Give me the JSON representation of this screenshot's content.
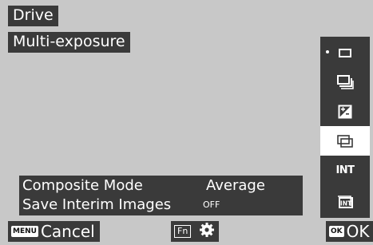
{
  "header": {
    "title": "Drive",
    "mode": "Multi-exposure"
  },
  "drive_options": [
    {
      "icon": "single-frame-icon",
      "selected": false,
      "current": true
    },
    {
      "icon": "continuous-shooting-icon",
      "selected": false,
      "current": false
    },
    {
      "icon": "exposure-bracketing-icon",
      "selected": false,
      "current": false
    },
    {
      "icon": "multi-exposure-icon",
      "selected": true,
      "current": false
    },
    {
      "icon": "interval-shooting-icon",
      "label": "INT",
      "selected": false,
      "current": false
    },
    {
      "icon": "interval-composite-icon",
      "label": "INT",
      "selected": false,
      "current": false
    }
  ],
  "info": {
    "composite_mode_label": "Composite Mode",
    "composite_mode_value": "Average",
    "save_interim_label": "Save Interim Images",
    "save_interim_value": "OFF"
  },
  "footer": {
    "menu_key": "MENU",
    "cancel_label": "Cancel",
    "fn_key": "Fn",
    "ok_key": "OK",
    "ok_label": "OK"
  },
  "colors": {
    "screen_bg": "#c8c8c8",
    "panel_bg": "#3a3a3a",
    "text": "#ffffff",
    "selected_bg": "#ffffff"
  }
}
